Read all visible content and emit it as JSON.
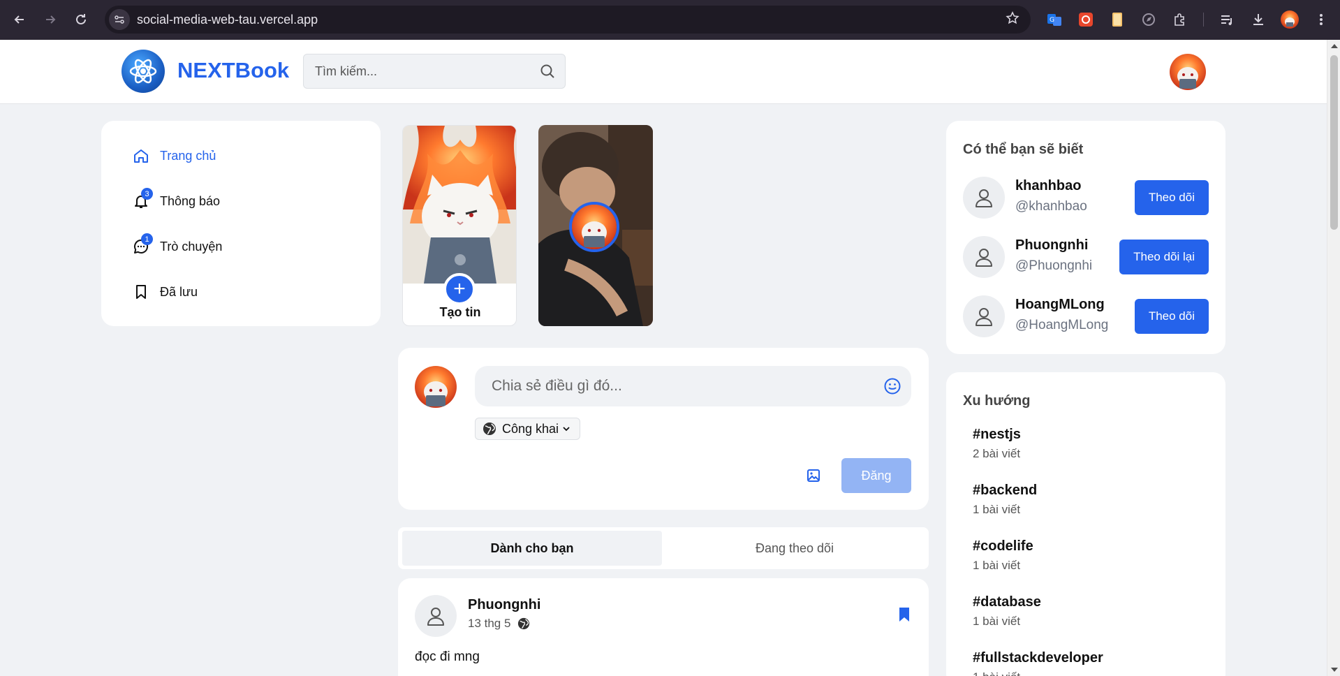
{
  "browser": {
    "url": "social-media-web-tau.vercel.app"
  },
  "header": {
    "brand": "NEXTBook",
    "search_placeholder": "Tìm kiếm..."
  },
  "sidebar": {
    "items": [
      {
        "label": "Trang chủ",
        "icon": "home-icon",
        "active": true
      },
      {
        "label": "Thông báo",
        "icon": "bell-icon",
        "badge": "3"
      },
      {
        "label": "Trò chuyện",
        "icon": "chat-icon",
        "badge": "1"
      },
      {
        "label": "Đã lưu",
        "icon": "bookmark-icon"
      }
    ]
  },
  "stories": {
    "create_label": "Tạo tin",
    "plus": "+"
  },
  "composer": {
    "placeholder": "Chia sẻ điều gì đó...",
    "privacy": "Công khai",
    "post_label": "Đăng"
  },
  "feed_tabs": {
    "for_you": "Dành cho bạn",
    "following": "Đang theo dõi"
  },
  "post": {
    "author": "Phuongnhi",
    "date": "13 thg 5",
    "text": "đọc đi mng"
  },
  "suggestions": {
    "title": "Có thể bạn sẽ biết",
    "users": [
      {
        "name": "khanhbao",
        "handle": "@khanhbao",
        "button": "Theo dõi"
      },
      {
        "name": "Phuongnhi",
        "handle": "@Phuongnhi",
        "button": "Theo dõi lại"
      },
      {
        "name": "HoangMLong",
        "handle": "@HoangMLong",
        "button": "Theo dõi"
      }
    ]
  },
  "trending": {
    "title": "Xu hướng",
    "items": [
      {
        "tag": "#nestjs",
        "count": "2 bài viết"
      },
      {
        "tag": "#backend",
        "count": "1 bài viết"
      },
      {
        "tag": "#codelife",
        "count": "1 bài viết"
      },
      {
        "tag": "#database",
        "count": "1 bài viết"
      },
      {
        "tag": "#fullstackdeveloper",
        "count": "1 bài viết"
      }
    ]
  },
  "colors": {
    "accent": "#2563eb",
    "accent_disabled": "#93b4f4",
    "page_bg": "#f0f2f5",
    "chrome_bg": "#2b2633"
  }
}
